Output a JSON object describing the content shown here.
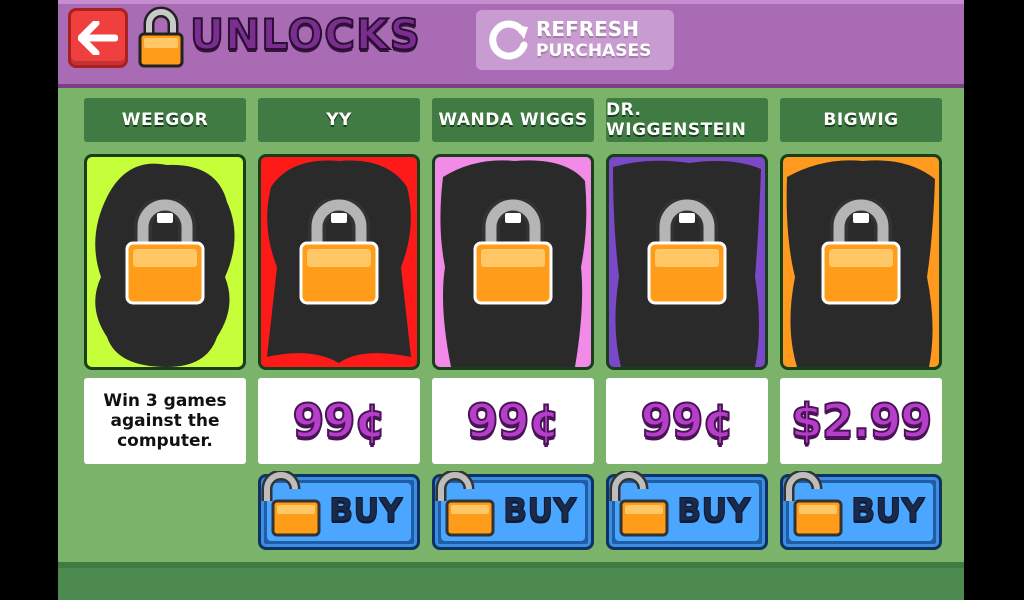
{
  "header": {
    "title": "UNLOCKS",
    "refresh": {
      "line1": "REFRESH",
      "line2": "PURCHASES"
    }
  },
  "colors": {
    "header": "#a96bb3",
    "background": "#7bb36b",
    "name_bar": "#3f7b42",
    "price": "#b63fc9",
    "buy": "#4aa6ff"
  },
  "characters": [
    {
      "name": "WEEGOR",
      "bg": "#c6ff3a",
      "requirement": "Win 3 games against the computer."
    },
    {
      "name": "YY",
      "bg": "#ff1a1a",
      "price": "99¢",
      "buy_label": "BUY"
    },
    {
      "name": "WANDA WIGGS",
      "bg": "#f28ae8",
      "price": "99¢",
      "buy_label": "BUY"
    },
    {
      "name": "DR. WIGGENSTEIN",
      "bg": "#7a48c8",
      "price": "99¢",
      "buy_label": "BUY"
    },
    {
      "name": "BIGWIG",
      "bg": "#ff9a1f",
      "price": "$2.99",
      "buy_label": "BUY"
    }
  ]
}
